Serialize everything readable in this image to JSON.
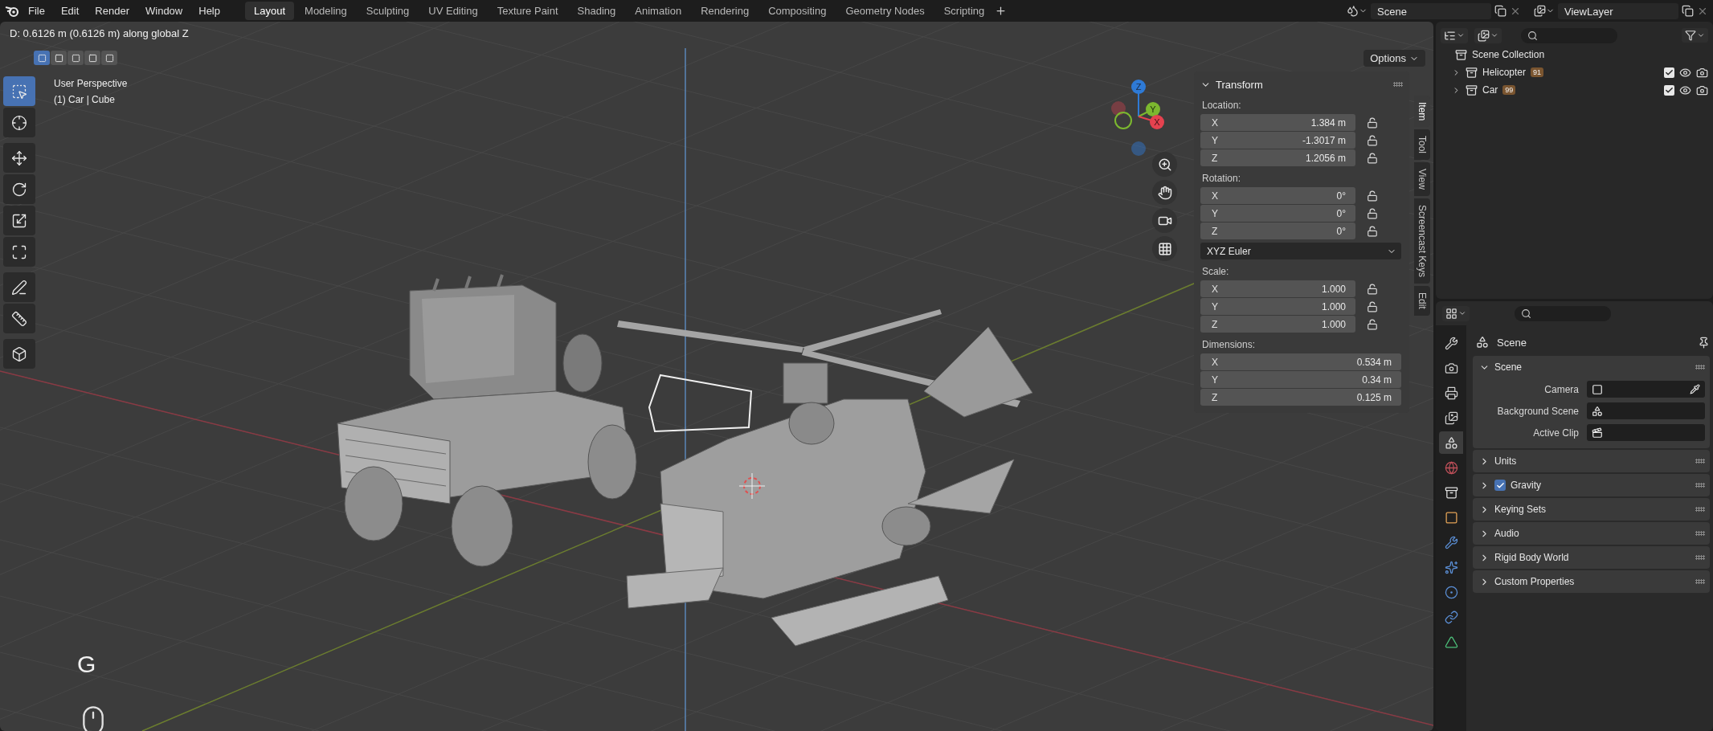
{
  "menu": [
    "File",
    "Edit",
    "Render",
    "Window",
    "Help"
  ],
  "workspaces": [
    {
      "label": "Layout",
      "selected": true
    },
    {
      "label": "Modeling",
      "selected": false
    },
    {
      "label": "Sculpting",
      "selected": false
    },
    {
      "label": "UV Editing",
      "selected": false
    },
    {
      "label": "Texture Paint",
      "selected": false
    },
    {
      "label": "Shading",
      "selected": false
    },
    {
      "label": "Animation",
      "selected": false
    },
    {
      "label": "Rendering",
      "selected": false
    },
    {
      "label": "Compositing",
      "selected": false
    },
    {
      "label": "Geometry Nodes",
      "selected": false
    },
    {
      "label": "Scripting",
      "selected": false
    }
  ],
  "scene_selector": {
    "value": "Scene"
  },
  "view_layer_selector": {
    "value": "ViewLayer"
  },
  "viewport": {
    "status": "D: 0.6126 m (0.6126 m) along global Z",
    "select_modes": [
      {
        "selected": true
      },
      {
        "selected": false
      },
      {
        "selected": false
      },
      {
        "selected": false
      },
      {
        "selected": false
      }
    ],
    "options": "Options",
    "view_name": "User Perspective",
    "object_name": "(1) Car | Cube",
    "tool_groups": [
      [
        {
          "kind": "select",
          "selected": true
        },
        {
          "kind": "cursor",
          "selected": false
        }
      ],
      [
        {
          "kind": "move",
          "selected": false
        },
        {
          "kind": "rotate",
          "selected": false
        },
        {
          "kind": "scale",
          "selected": false
        },
        {
          "kind": "transform",
          "selected": false
        }
      ],
      [
        {
          "kind": "annotate",
          "selected": false
        },
        {
          "kind": "measure",
          "selected": false
        }
      ],
      [
        {
          "kind": "add",
          "selected": false
        }
      ]
    ],
    "gizmo": [
      {
        "label": "Z",
        "color": "#2e7ad6"
      },
      {
        "label": "Y",
        "color": "#7cb82f"
      },
      {
        "label": "X",
        "color": "#e5424f"
      }
    ],
    "screencast_key": "G"
  },
  "sidebar": {
    "tabs": [
      {
        "label": "Item",
        "selected": true
      },
      {
        "label": "Tool",
        "selected": false
      },
      {
        "label": "View",
        "selected": false
      },
      {
        "label": "Screencast Keys",
        "selected": false
      },
      {
        "label": "Edit",
        "selected": false
      }
    ],
    "panel_title": "Transform",
    "groups": [
      {
        "label": "Location:",
        "lockable": true,
        "fields": [
          {
            "axis": "X",
            "value": "1.384 m"
          },
          {
            "axis": "Y",
            "value": "-1.3017 m"
          },
          {
            "axis": "Z",
            "value": "1.2056 m"
          }
        ]
      },
      {
        "label": "Rotation:",
        "lockable": true,
        "mode": "XYZ Euler",
        "fields": [
          {
            "axis": "X",
            "value": "0°"
          },
          {
            "axis": "Y",
            "value": "0°"
          },
          {
            "axis": "Z",
            "value": "0°"
          }
        ]
      },
      {
        "label": "Scale:",
        "lockable": true,
        "fields": [
          {
            "axis": "X",
            "value": "1.000"
          },
          {
            "axis": "Y",
            "value": "1.000"
          },
          {
            "axis": "Z",
            "value": "1.000"
          }
        ]
      },
      {
        "label": "Dimensions:",
        "lockable": false,
        "fields": [
          {
            "axis": "X",
            "value": "0.534 m"
          },
          {
            "axis": "Y",
            "value": "0.34 m"
          },
          {
            "axis": "Z",
            "value": "0.125 m"
          }
        ]
      }
    ]
  },
  "outliner": {
    "root": "Scene Collection",
    "items": [
      {
        "label": "Helicopter",
        "badge": "91",
        "expanded": false,
        "checked": true
      },
      {
        "label": "Car",
        "badge": "99",
        "expanded": false,
        "checked": true
      }
    ]
  },
  "properties": {
    "tabs": [
      {
        "kind": "tool",
        "selected": false
      },
      {
        "kind": "render",
        "selected": false
      },
      {
        "kind": "output",
        "selected": false
      },
      {
        "kind": "viewlayer",
        "selected": false
      },
      {
        "kind": "scene",
        "selected": true
      },
      {
        "kind": "world",
        "selected": false
      },
      {
        "kind": "collection",
        "selected": false
      },
      {
        "kind": "object",
        "selected": false
      },
      {
        "kind": "modifier",
        "selected": false
      },
      {
        "kind": "particles",
        "selected": false
      },
      {
        "kind": "physics",
        "selected": false
      },
      {
        "kind": "constraints",
        "selected": false
      },
      {
        "kind": "data",
        "selected": false
      }
    ],
    "context": "Scene",
    "panels": [
      {
        "label": "Scene",
        "expanded": true,
        "fields": [
          {
            "label": "Camera",
            "kind": "camera"
          },
          {
            "label": "Background Scene",
            "kind": "scene"
          },
          {
            "label": "Active Clip",
            "kind": "clip"
          }
        ]
      },
      {
        "label": "Units",
        "expanded": false
      },
      {
        "label": "Gravity",
        "expanded": false,
        "checked": true
      },
      {
        "label": "Keying Sets",
        "expanded": false
      },
      {
        "label": "Audio",
        "expanded": false
      },
      {
        "label": "Rigid Body World",
        "expanded": false
      },
      {
        "label": "Custom Properties",
        "expanded": false
      }
    ]
  }
}
